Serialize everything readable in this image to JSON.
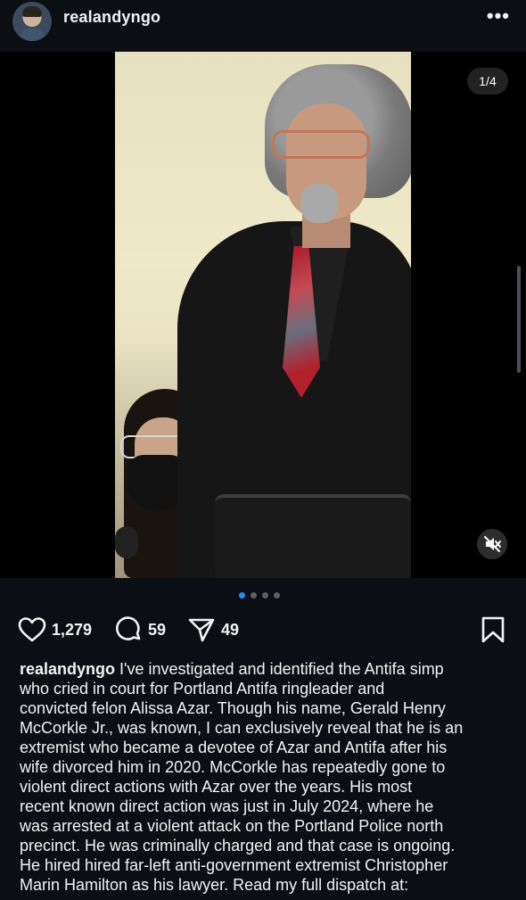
{
  "header": {
    "username": "realandyngo",
    "more_label": "•••"
  },
  "media": {
    "counter": "1/4",
    "total_slides": 4,
    "active_slide": 1
  },
  "actions": {
    "likes": "1,279",
    "comments": "59",
    "shares": "49"
  },
  "caption": {
    "user": "realandyngo",
    "lines": [
      " I've investigated and identified the Antifa simp",
      "who cried in court for Portland Antifa ringleader and",
      "convicted felon Alissa Azar. Though his name, Gerald Henry",
      "McCorkle Jr., was known, I can exclusively reveal that he is an",
      "extremist who became a devotee of Azar and Antifa after his",
      "wife divorced him in 2020. McCorkle has repeatedly gone to",
      "violent direct actions with Azar over the years. His most",
      "recent known direct action was just in July 2024, where he",
      "was arrested at a violent attack on the Portland Police north",
      "precinct. He was criminally charged and that case is ongoing.",
      "He hired hired far-left anti-government extremist Christopher",
      "Marin Hamilton as his lawyer. Read my full dispatch at:"
    ]
  },
  "colors": {
    "background": "#0b0f14",
    "active_dot": "#1f8ff5",
    "text": "#f2f2f2"
  },
  "icons": [
    "more-icon",
    "heart-icon",
    "comment-icon",
    "share-icon",
    "bookmark-icon",
    "mute-icon"
  ]
}
